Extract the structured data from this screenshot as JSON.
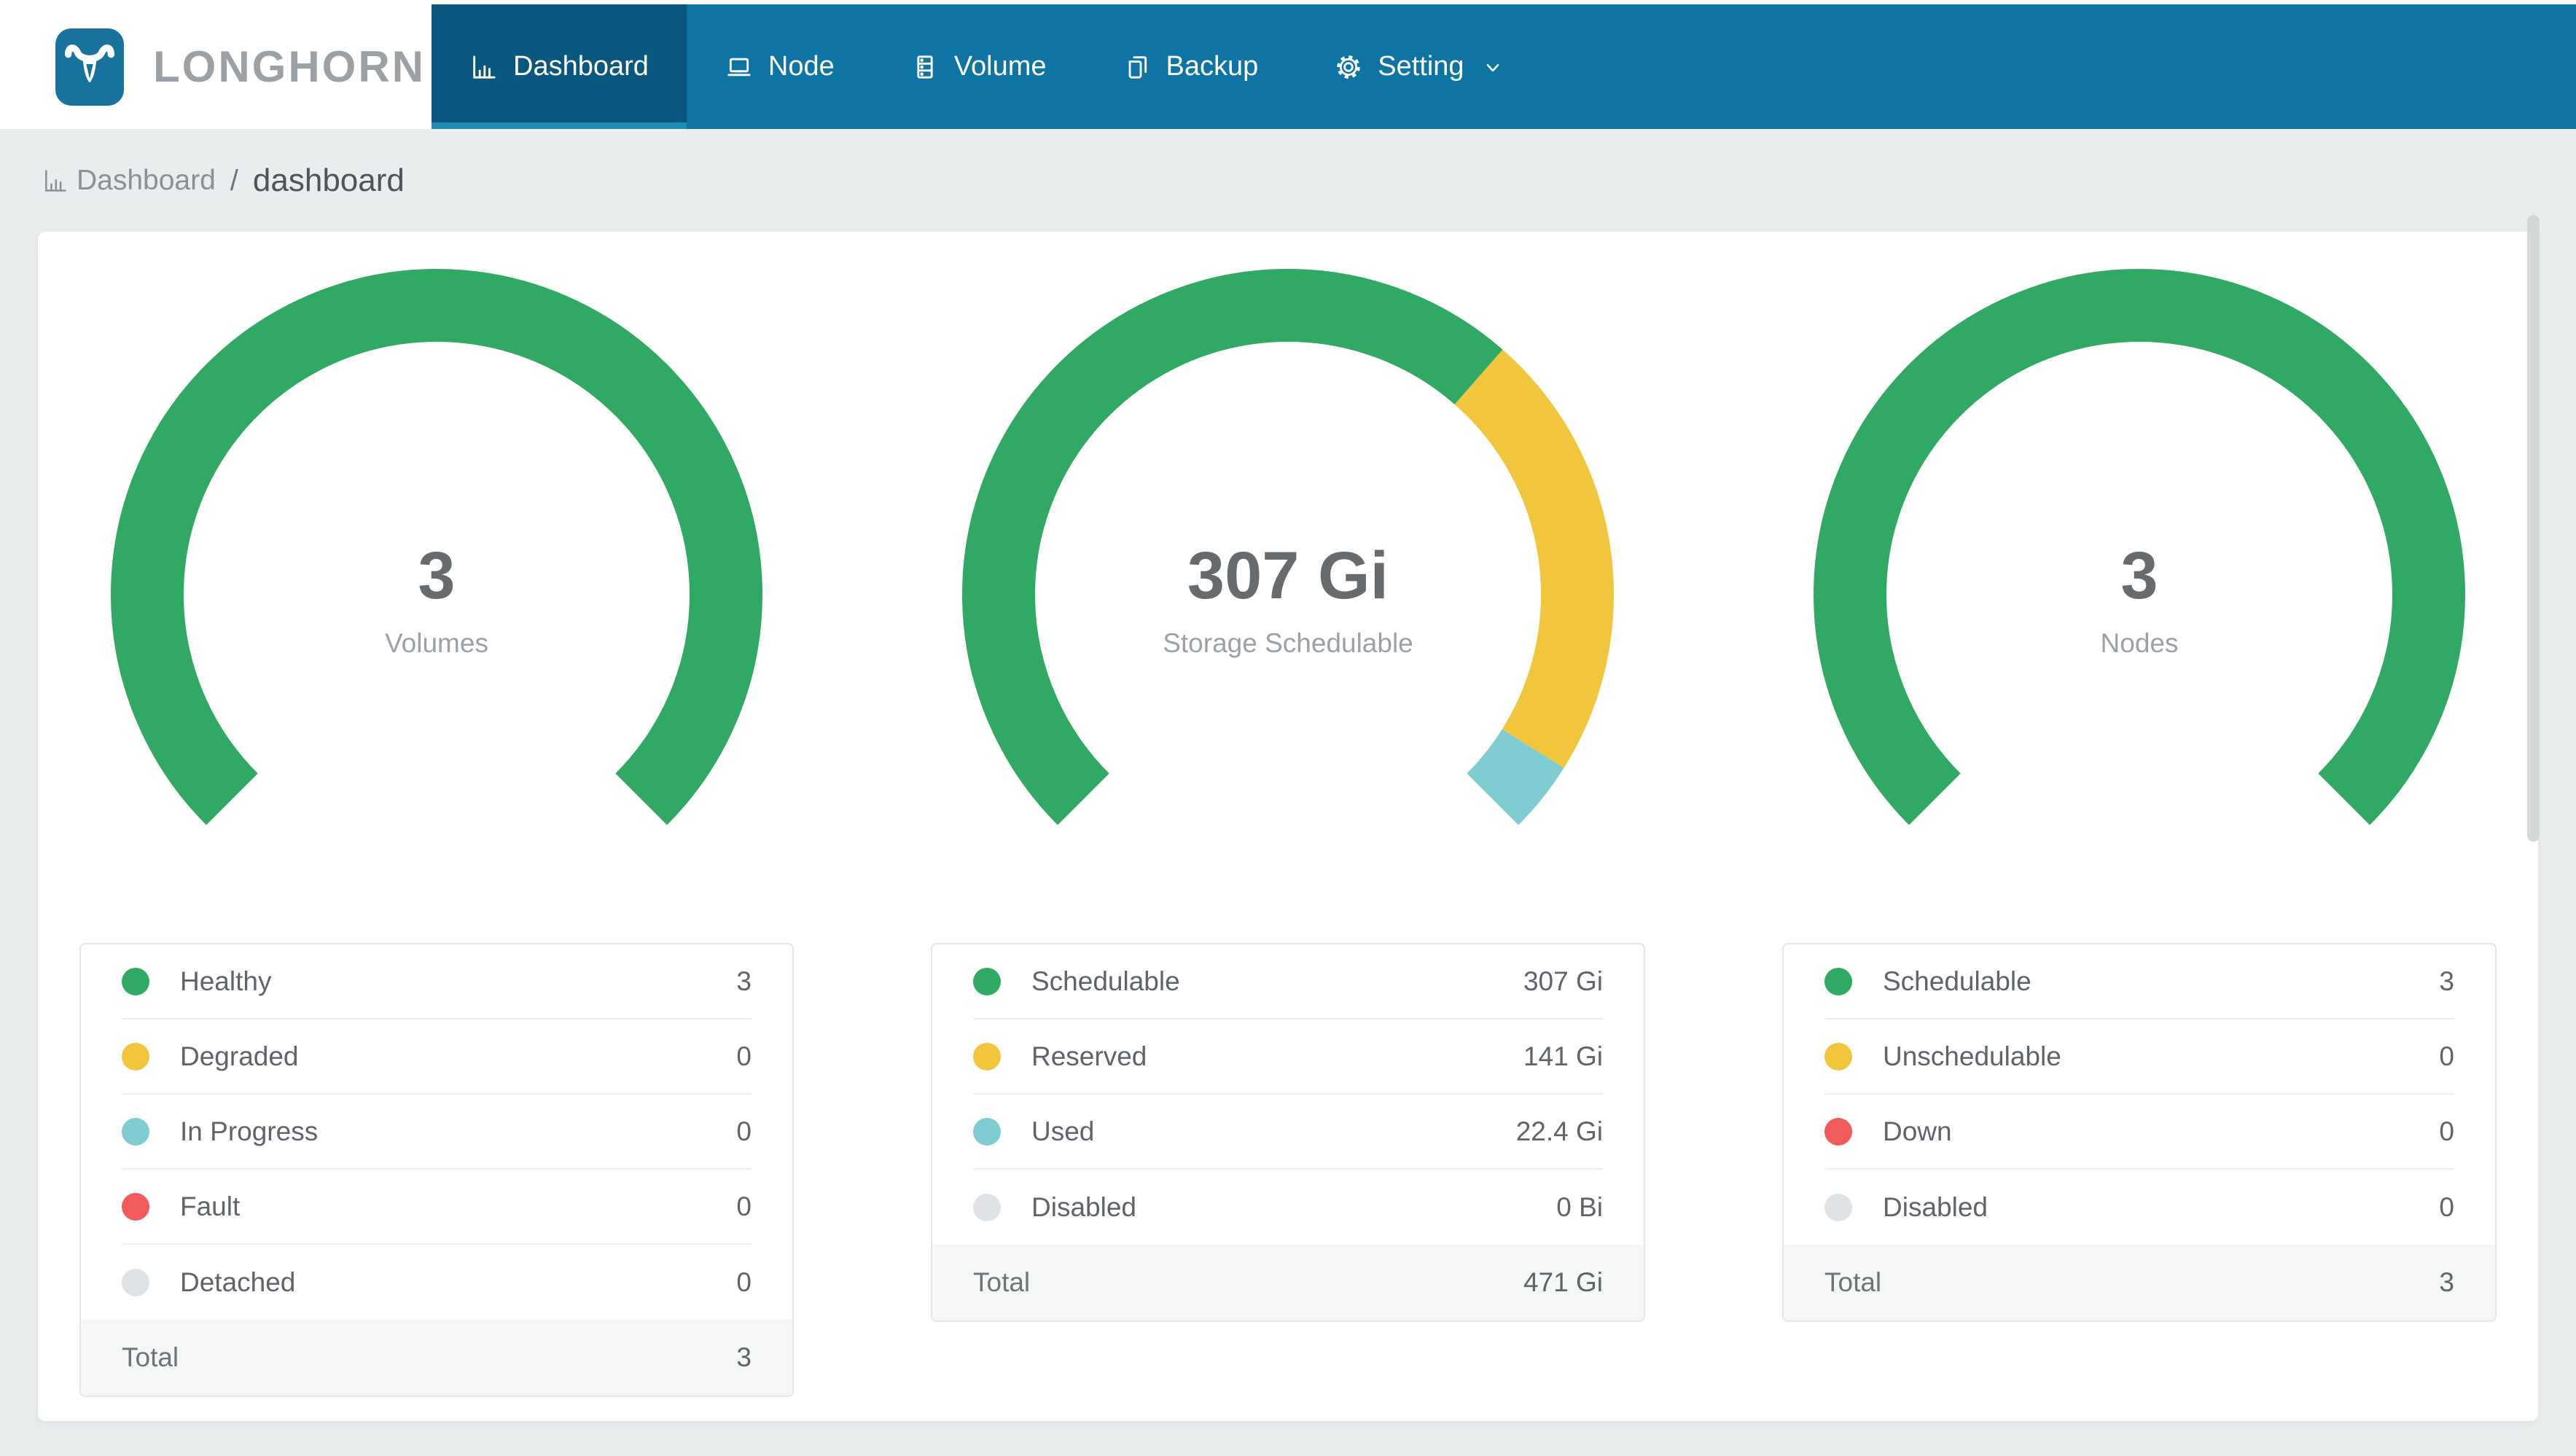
{
  "nav": {
    "logo_text": "LONGHORN",
    "items": [
      {
        "label": "Dashboard",
        "icon": "bar-chart-icon",
        "active": true
      },
      {
        "label": "Node",
        "icon": "laptop-icon",
        "active": false
      },
      {
        "label": "Volume",
        "icon": "server-icon",
        "active": false
      },
      {
        "label": "Backup",
        "icon": "copy-icon",
        "active": false
      },
      {
        "label": "Setting",
        "icon": "gear-icon",
        "active": false,
        "has_dropdown": true
      }
    ]
  },
  "breadcrumb": {
    "icon": "bar-chart-icon",
    "section": "Dashboard",
    "separator": "/",
    "page": "dashboard"
  },
  "colors": {
    "navbar_bg": "#0E74A3",
    "navbar_active_bg": "#09567F",
    "navbar_active_strip": "#1F8DB6",
    "logo_blue": "#17729E",
    "page_bg": "#E9EDEE",
    "card_bg": "#FFFFFF",
    "green": "#2FA963",
    "yellow": "#F2C63C",
    "teal": "#7FCBD2",
    "red": "#F15B5B",
    "gray": "#E0E3E6"
  },
  "chart_data": [
    {
      "type": "gauge",
      "center_value": "3",
      "center_label": "Volumes",
      "start_angle": 225,
      "sweep_angle": 270,
      "segments": [
        {
          "name": "Healthy",
          "value": 3,
          "color": "#2FA963"
        },
        {
          "name": "Degraded",
          "value": 0,
          "color": "#F2C63C"
        },
        {
          "name": "In Progress",
          "value": 0,
          "color": "#7FCBD2"
        },
        {
          "name": "Fault",
          "value": 0,
          "color": "#F15B5B"
        },
        {
          "name": "Detached",
          "value": 0,
          "color": "#E0E3E6"
        }
      ],
      "legend": {
        "rows": [
          {
            "label": "Healthy",
            "value": "3",
            "color": "#2FA963"
          },
          {
            "label": "Degraded",
            "value": "0",
            "color": "#F2C63C"
          },
          {
            "label": "In Progress",
            "value": "0",
            "color": "#7FCBD2"
          },
          {
            "label": "Fault",
            "value": "0",
            "color": "#F15B5B"
          },
          {
            "label": "Detached",
            "value": "0",
            "color": "#E0E3E6"
          }
        ],
        "total_label": "Total",
        "total_value": "3"
      }
    },
    {
      "type": "gauge",
      "center_value": "307 Gi",
      "center_label": "Storage Schedulable",
      "start_angle": 225,
      "sweep_angle": 270,
      "segments": [
        {
          "name": "Schedulable",
          "value": 307,
          "color": "#2FA963"
        },
        {
          "name": "Reserved",
          "value": 141,
          "color": "#F2C63C"
        },
        {
          "name": "Used",
          "value": 22.4,
          "color": "#7FCBD2"
        },
        {
          "name": "Disabled",
          "value": 0,
          "color": "#E0E3E6"
        }
      ],
      "legend": {
        "rows": [
          {
            "label": "Schedulable",
            "value": "307 Gi",
            "color": "#2FA963"
          },
          {
            "label": "Reserved",
            "value": "141 Gi",
            "color": "#F2C63C"
          },
          {
            "label": "Used",
            "value": "22.4 Gi",
            "color": "#7FCBD2"
          },
          {
            "label": "Disabled",
            "value": "0 Bi",
            "color": "#E0E3E6"
          }
        ],
        "total_label": "Total",
        "total_value": "471 Gi"
      }
    },
    {
      "type": "gauge",
      "center_value": "3",
      "center_label": "Nodes",
      "start_angle": 225,
      "sweep_angle": 270,
      "segments": [
        {
          "name": "Schedulable",
          "value": 3,
          "color": "#2FA963"
        },
        {
          "name": "Unschedulable",
          "value": 0,
          "color": "#F2C63C"
        },
        {
          "name": "Down",
          "value": 0,
          "color": "#F15B5B"
        },
        {
          "name": "Disabled",
          "value": 0,
          "color": "#E0E3E6"
        }
      ],
      "legend": {
        "rows": [
          {
            "label": "Schedulable",
            "value": "3",
            "color": "#2FA963"
          },
          {
            "label": "Unschedulable",
            "value": "0",
            "color": "#F2C63C"
          },
          {
            "label": "Down",
            "value": "0",
            "color": "#F15B5B"
          },
          {
            "label": "Disabled",
            "value": "0",
            "color": "#E0E3E6"
          }
        ],
        "total_label": "Total",
        "total_value": "3"
      }
    }
  ]
}
